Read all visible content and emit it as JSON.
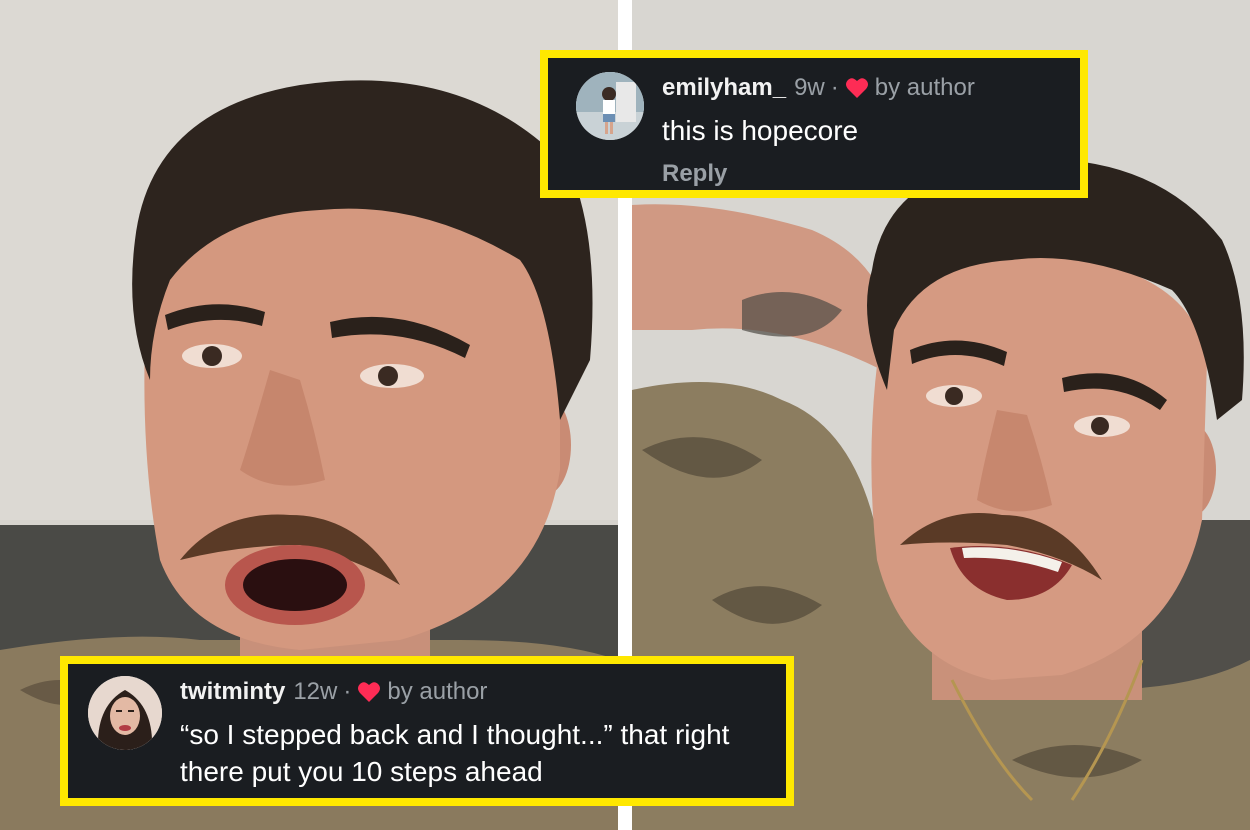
{
  "images": {
    "left_photo": {
      "icon": "man-speaking-photo"
    },
    "right_photo": {
      "icon": "man-smiling-photo"
    }
  },
  "comments": [
    {
      "username": "emilyham_",
      "age": "9w",
      "separator": "·",
      "liked_by_label": "by author",
      "heart_icon": "heart-icon",
      "heart_color": "#fe2c55",
      "text": "this is hopecore",
      "reply_label": "Reply"
    },
    {
      "username": "twitminty",
      "age": "12w",
      "separator": "·",
      "liked_by_label": "by author",
      "heart_icon": "heart-icon",
      "heart_color": "#fe2c55",
      "text": "“so I stepped back and I thought...” that right there put you 10 steps ahead"
    }
  ],
  "colors": {
    "highlight_border": "#ffe800",
    "comment_background": "#1a1d21",
    "muted_text": "#9aa0a6"
  }
}
